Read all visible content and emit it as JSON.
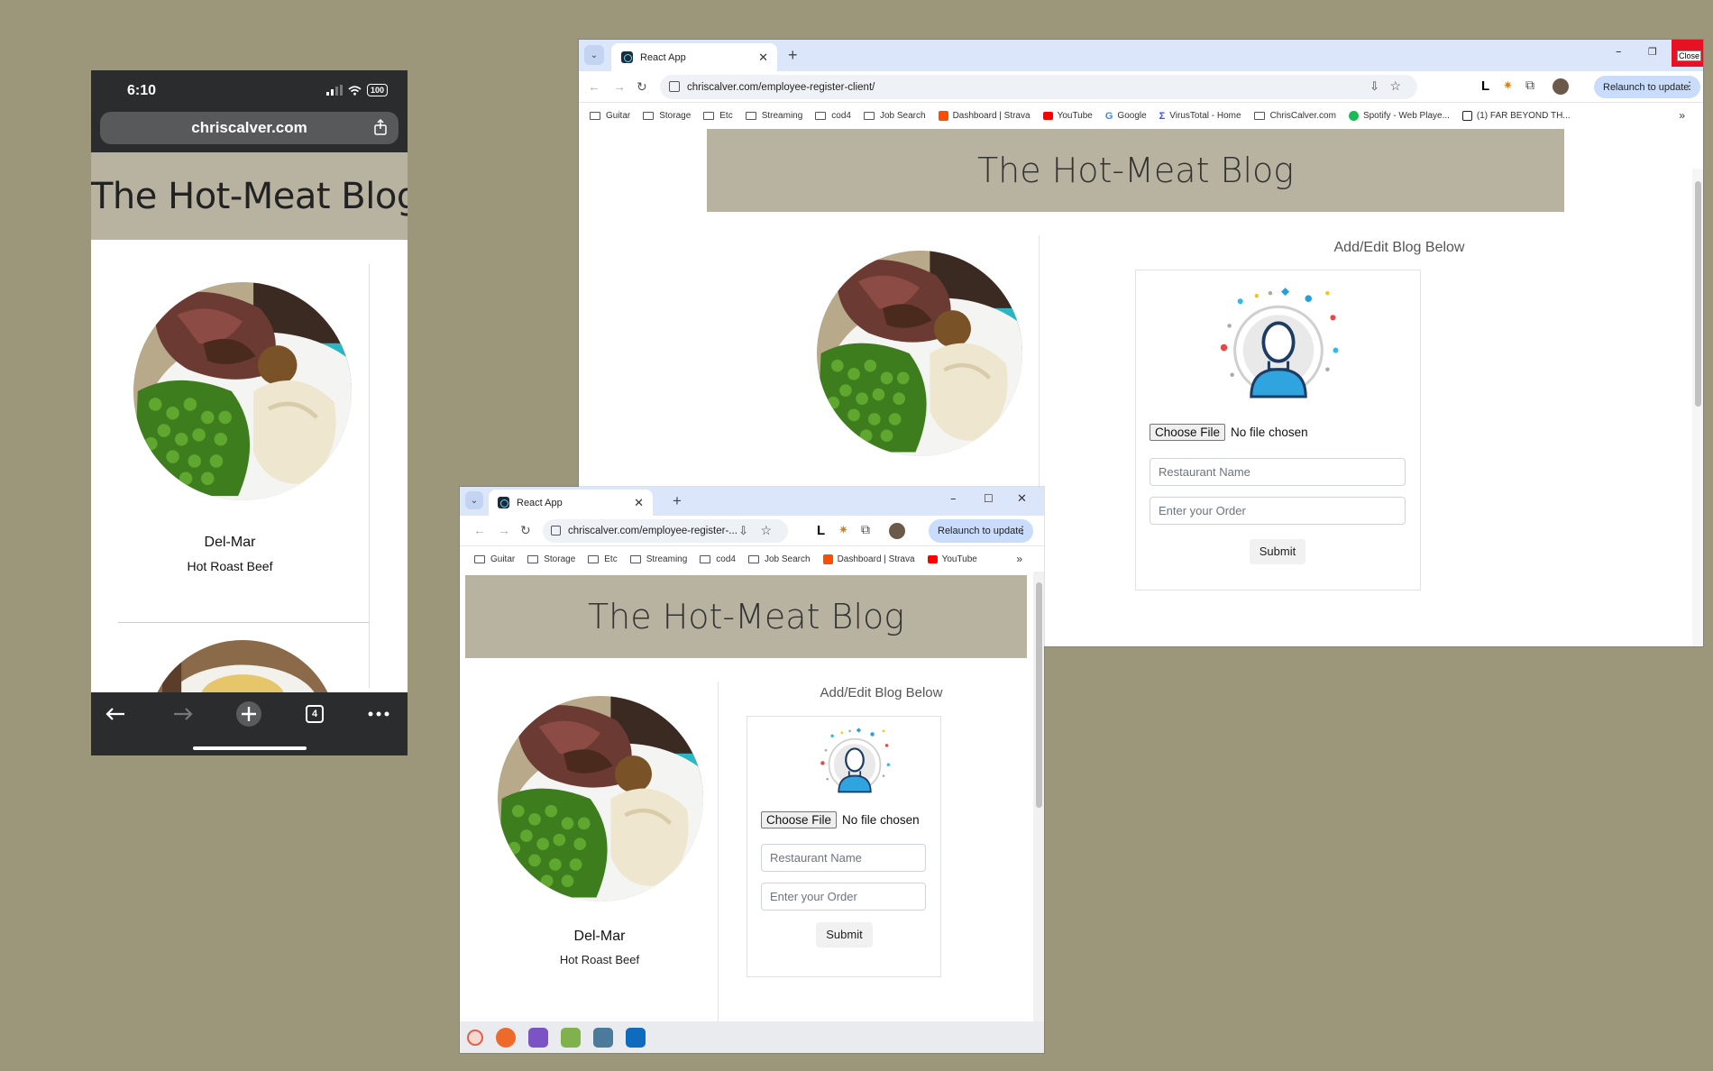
{
  "phone": {
    "time": "6:10",
    "battery": "100",
    "url": "chriscalver.com",
    "blog_title": "The Hot-Meat Blog",
    "entry": {
      "restaurant": "Del-Mar",
      "dish": "Hot Roast Beef"
    },
    "tab_count": "4"
  },
  "browser_main": {
    "tab_title": "React App",
    "url": "chriscalver.com/employee-register-client/",
    "relaunch": "Relaunch to update",
    "close_tooltip": "Close",
    "bookmarks": [
      "Guitar",
      "Storage",
      "Etc",
      "Streaming",
      "cod4",
      "Job Search",
      "Dashboard | Strava",
      "YouTube",
      "Google",
      "VirusTotal - Home",
      "ChrisCalver.com",
      "Spotify - Web Playe...",
      "(1) FAR BEYOND TH..."
    ],
    "blog_title": "The Hot-Meat Blog",
    "form_title": "Add/Edit Blog Below",
    "choose_file": "Choose File",
    "no_file": "No file chosen",
    "restaurant_placeholder": "Restaurant Name",
    "order_placeholder": "Enter your Order",
    "submit": "Submit"
  },
  "browser_small": {
    "tab_title": "React App",
    "url": "chriscalver.com/employee-register-...",
    "relaunch": "Relaunch to update",
    "bookmarks": [
      "Guitar",
      "Storage",
      "Etc",
      "Streaming",
      "cod4",
      "Job Search",
      "Dashboard | Strava",
      "YouTube"
    ],
    "blog_title": "The Hot-Meat Blog",
    "form_title": "Add/Edit Blog Below",
    "choose_file": "Choose File",
    "no_file": "No file chosen",
    "restaurant_placeholder": "Restaurant Name",
    "order_placeholder": "Enter your Order",
    "submit": "Submit",
    "entry": {
      "restaurant": "Del-Mar",
      "dish": "Hot Roast Beef"
    }
  },
  "colors": {
    "desktop": "#9c977b",
    "banner": "#b8b3a0",
    "tabbar": "#dbe6fb",
    "close_red": "#e81123"
  }
}
